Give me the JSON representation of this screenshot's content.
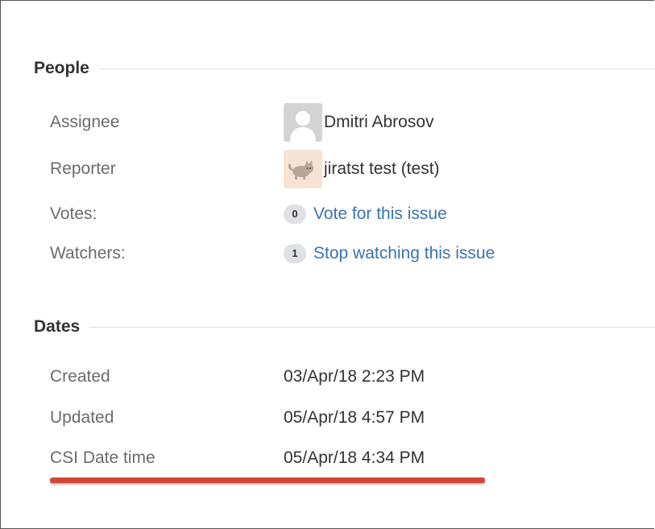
{
  "people": {
    "heading": "People",
    "assignee": {
      "label": "Assignee",
      "value": "Dmitri Abrosov"
    },
    "reporter": {
      "label": "Reporter",
      "value": "jiratst test (test)"
    },
    "votes": {
      "label": "Votes:",
      "count": "0",
      "link": "Vote for this issue"
    },
    "watchers": {
      "label": "Watchers:",
      "count": "1",
      "link": "Stop watching this issue"
    }
  },
  "dates": {
    "heading": "Dates",
    "created": {
      "label": "Created",
      "value": "03/Apr/18 2:23 PM"
    },
    "updated": {
      "label": "Updated",
      "value": "05/Apr/18 4:57 PM"
    },
    "csi": {
      "label": "CSI Date time",
      "value": "05/Apr/18 4:34 PM"
    }
  },
  "colors": {
    "link": "#3b73af",
    "highlight_underline": "#d2453a"
  },
  "icons": {
    "assignee_avatar": "default-user-avatar-icon",
    "reporter_avatar": "cat-avatar-icon"
  }
}
